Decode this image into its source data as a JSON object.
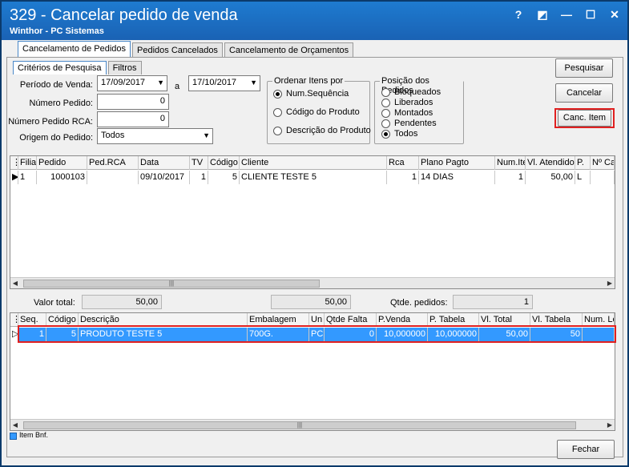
{
  "window": {
    "title": "329 - Cancelar pedido de venda",
    "subtitle": "Winthor - PC Sistemas",
    "buttons": [
      "?",
      "◩",
      "—",
      "☐",
      "✕"
    ]
  },
  "tabs": [
    "Cancelamento de Pedidos",
    "Pedidos Cancelados",
    "Cancelamento de Orçamentos"
  ],
  "subtabs": [
    "Critérios de Pesquisa",
    "Filtros"
  ],
  "form": {
    "periodo_label": "Período de Venda:",
    "data_ini": "17/09/2017",
    "a_label": "a",
    "data_fim": "17/10/2017",
    "numero_pedido_label": "Número Pedido:",
    "numero_pedido": "0",
    "numero_rca_label": "Número Pedido RCA:",
    "numero_rca": "0",
    "origem_label": "Origem do Pedido:",
    "origem": "Todos"
  },
  "ordenar": {
    "title": "Ordenar Itens por",
    "options": [
      "Num.Sequência",
      "Código do Produto",
      "Descrição do Produto"
    ],
    "selected": 0
  },
  "posicao": {
    "title": "Posição dos Pedidos",
    "options": [
      "Bloqueados",
      "Liberados",
      "Montados",
      "Pendentes",
      "Todos"
    ],
    "selected": 4
  },
  "actions": {
    "pesquisar": "Pesquisar",
    "cancelar": "Cancelar",
    "canc_item": "Canc. Item",
    "fechar": "Fechar"
  },
  "pedidos_grid": {
    "headers": [
      "Filia",
      "Pedido",
      "Ped.RCA",
      "Data",
      "TV",
      "Código",
      "Cliente",
      "Rca",
      "Plano Pagto",
      "Num.Ite",
      "Vl. Atendido",
      "P.",
      "Nº Ca"
    ],
    "rows": [
      [
        "1",
        "1000103",
        "",
        "09/10/2017",
        "1",
        "5",
        "CLIENTE TESTE 5",
        "1",
        "14 DIAS",
        "1",
        "50,00",
        "L",
        ""
      ]
    ]
  },
  "totals": {
    "valor_total_label": "Valor total:",
    "valor_total": "50,00",
    "valor_total2": "50,00",
    "qtde_label": "Qtde. pedidos:",
    "qtde": "1"
  },
  "itens_grid": {
    "headers": [
      "Seq.",
      "Código",
      "Descrição",
      "Embalagem",
      "Un",
      "Qtde Falta",
      "P.Venda",
      "P. Tabela",
      "Vl. Total",
      "Vl. Tabela",
      "Num. Lo"
    ],
    "rows": [
      [
        "1",
        "5",
        "PRODUTO TESTE 5",
        "700G.",
        "PC",
        "0",
        "10,000000",
        "10,000000",
        "50,00",
        "50",
        ""
      ]
    ]
  },
  "legend": {
    "label": "Item Bnf."
  }
}
